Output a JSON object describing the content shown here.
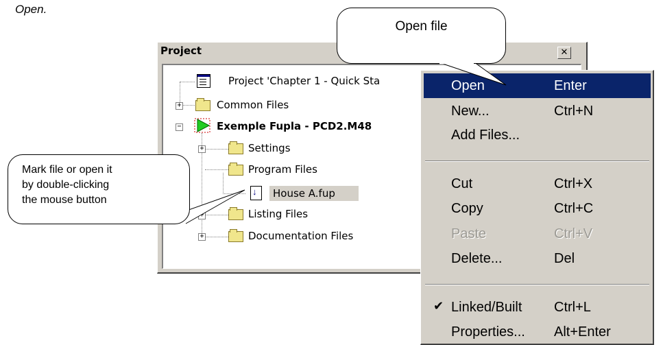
{
  "intro_text": "Open.",
  "window": {
    "title": "Project",
    "close_glyph": "✕"
  },
  "tree": {
    "project": "Project 'Chapter 1 - Quick Sta",
    "common_files": "Common Files",
    "device": "Exemple Fupla - PCD2.M48",
    "settings": "Settings",
    "program_files": "Program Files",
    "house_file": "House A.fup",
    "listing_files": "Listing Files",
    "documentation_files": "Documentation Files"
  },
  "menu": {
    "items": [
      {
        "label": "Open",
        "shortcut": "Enter"
      },
      {
        "label": "New...",
        "shortcut": "Ctrl+N"
      },
      {
        "label": "Add Files...",
        "shortcut": ""
      },
      {
        "label": "Cut",
        "shortcut": "Ctrl+X"
      },
      {
        "label": "Copy",
        "shortcut": "Ctrl+C"
      },
      {
        "label": "Paste",
        "shortcut": "Ctrl+V"
      },
      {
        "label": "Delete...",
        "shortcut": "Del"
      },
      {
        "label": "Linked/Built",
        "shortcut": "Ctrl+L",
        "check": "✔"
      },
      {
        "label": "Properties...",
        "shortcut": "Alt+Enter"
      }
    ]
  },
  "callouts": {
    "open_file": "Open file",
    "mark_file_line1": "Mark file or open it",
    "mark_file_line2": "by double-clicking",
    "mark_file_line3": "the mouse button"
  },
  "colors": {
    "highlight": "#0a246a",
    "panel": "#d4d0c8",
    "folder": "#f0e68c",
    "play_green": "#22cc22"
  }
}
